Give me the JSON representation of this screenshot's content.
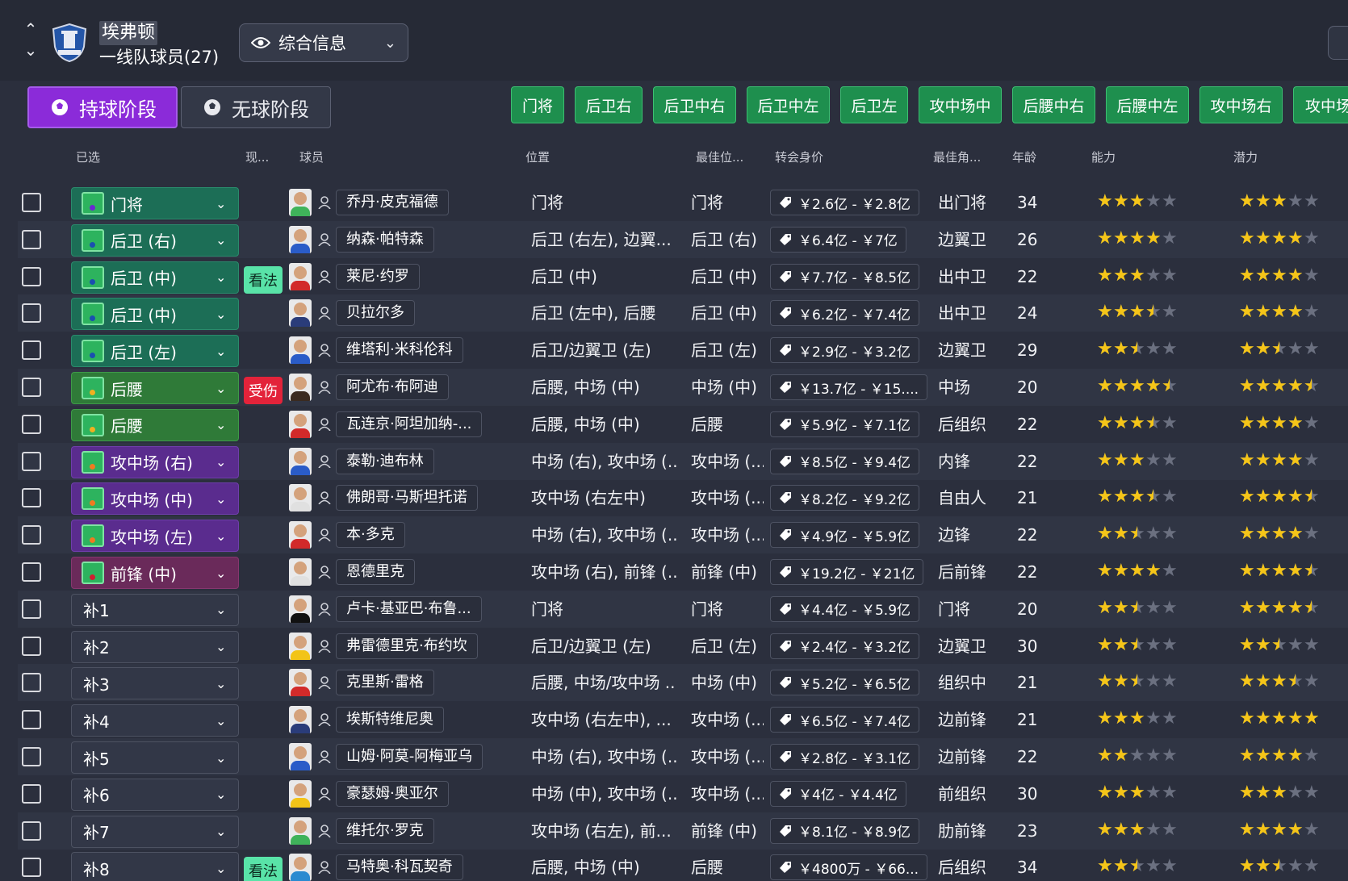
{
  "header": {
    "club_name": "埃弗顿",
    "squad_label": "一线队球员(27)",
    "view_select": "综合信息"
  },
  "phases": {
    "in_possession": "持球阶段",
    "out_of_possession": "无球阶段"
  },
  "position_tabs": [
    "门将",
    "后卫右",
    "后卫中右",
    "后卫中左",
    "后卫左",
    "攻中场中",
    "后腰中右",
    "后腰中左",
    "攻中场右",
    "攻中场"
  ],
  "columns": {
    "selected": "已选",
    "status": "现...",
    "player": "球员",
    "position": "位置",
    "best_position": "最佳位...",
    "transfer_value": "转会身价",
    "best_role": "最佳角...",
    "age": "年龄",
    "ability": "能力",
    "potential": "潜力"
  },
  "colors": {
    "star": "#f5c518",
    "pitch": "#2db35e",
    "phase_active": "#8b2bd9",
    "tab": "#1e8f4e"
  },
  "rows": [
    {
      "role": "门将",
      "type": "gk",
      "tag": "",
      "name": "乔丹·皮克福德",
      "position": "门将",
      "best_pos": "门将",
      "value": "￥2.6亿 - ￥2.8亿",
      "best_role": "出门将",
      "age": "34",
      "ability": 3,
      "potential": 3,
      "kit": "#3fb35a"
    },
    {
      "role": "后卫 (右)",
      "type": "def",
      "tag": "",
      "name": "纳森·帕特森",
      "position": "后卫 (右左), 边翼...",
      "best_pos": "后卫 (右)",
      "value": "￥6.4亿 - ￥7亿",
      "best_role": "边翼卫",
      "age": "26",
      "ability": 4,
      "potential": 4,
      "kit": "#2a5cc8"
    },
    {
      "role": "后卫 (中)",
      "type": "def",
      "tag": "看法",
      "tagType": "view",
      "name": "莱尼·约罗",
      "position": "后卫 (中)",
      "best_pos": "后卫 (中)",
      "value": "￥7.7亿 - ￥8.5亿",
      "best_role": "出中卫",
      "age": "22",
      "ability": 3,
      "potential": 4,
      "kit": "#d22a2a"
    },
    {
      "role": "后卫 (中)",
      "type": "def",
      "tag": "",
      "name": "贝拉尔多",
      "position": "后卫 (左中), 后腰",
      "best_pos": "后卫 (中)",
      "value": "￥6.2亿 - ￥7.4亿",
      "best_role": "出中卫",
      "age": "24",
      "ability": 3.5,
      "potential": 4,
      "kit": "#2a3c7a"
    },
    {
      "role": "后卫 (左)",
      "type": "def",
      "tag": "",
      "name": "维塔利·米科伦科",
      "position": "后卫/边翼卫 (左)",
      "best_pos": "后卫 (左)",
      "value": "￥2.9亿 - ￥3.2亿",
      "best_role": "边翼卫",
      "age": "29",
      "ability": 2.5,
      "potential": 2.5,
      "kit": "#2a5cc8"
    },
    {
      "role": "后腰",
      "type": "dm",
      "tag": "受伤",
      "tagType": "inj",
      "name": "阿尤布·布阿迪",
      "position": "后腰, 中场 (中)",
      "best_pos": "中场 (中)",
      "value": "￥13.7亿 - ￥15....",
      "best_role": "中场",
      "age": "20",
      "ability": 4.5,
      "potential": 4.5,
      "kit": "#3a2a20"
    },
    {
      "role": "后腰",
      "type": "dm",
      "tag": "",
      "name": "瓦连京·阿坦加纳-...",
      "position": "后腰, 中场 (中)",
      "best_pos": "后腰",
      "value": "￥5.9亿 - ￥7.1亿",
      "best_role": "后组织",
      "age": "22",
      "ability": 3.5,
      "potential": 4,
      "kit": "#d22a2a"
    },
    {
      "role": "攻中场 (右)",
      "type": "am",
      "tag": "",
      "name": "泰勒·迪布林",
      "position": "中场 (右), 攻中场 (...",
      "best_pos": "攻中场 (...",
      "value": "￥8.5亿 - ￥9.4亿",
      "best_role": "内锋",
      "age": "22",
      "ability": 3,
      "potential": 4,
      "kit": "#2a5cc8"
    },
    {
      "role": "攻中场 (中)",
      "type": "am",
      "tag": "",
      "name": "佛朗哥·马斯坦托诺",
      "position": "攻中场 (右左中)",
      "best_pos": "攻中场 (...",
      "value": "￥8.2亿 - ￥9.2亿",
      "best_role": "自由人",
      "age": "21",
      "ability": 3.5,
      "potential": 4.5,
      "kit": "#e0e0e0"
    },
    {
      "role": "攻中场 (左)",
      "type": "am",
      "tag": "",
      "name": "本·多克",
      "position": "中场 (右), 攻中场 (...",
      "best_pos": "攻中场 (...",
      "value": "￥4.9亿 - ￥5.9亿",
      "best_role": "边锋",
      "age": "22",
      "ability": 2.5,
      "potential": 4,
      "kit": "#d22a2a"
    },
    {
      "role": "前锋 (中)",
      "type": "st",
      "tag": "",
      "name": "恩德里克",
      "position": "攻中场 (右), 前锋 (...",
      "best_pos": "前锋 (中)",
      "value": "￥19.2亿 - ￥21亿",
      "best_role": "后前锋",
      "age": "22",
      "ability": 4,
      "potential": 4.5,
      "kit": "#e0e0e0"
    },
    {
      "role": "补1",
      "type": "sub",
      "tag": "",
      "name": "卢卡·基亚巴·布鲁...",
      "position": "门将",
      "best_pos": "门将",
      "value": "￥4.4亿 - ￥5.9亿",
      "best_role": "门将",
      "age": "20",
      "ability": 2.5,
      "potential": 4.5,
      "kit": "#111111"
    },
    {
      "role": "补2",
      "type": "sub",
      "tag": "",
      "name": "弗雷德里克·布约坎",
      "position": "后卫/边翼卫 (左)",
      "best_pos": "后卫 (左)",
      "value": "￥2.4亿 - ￥3.2亿",
      "best_role": "边翼卫",
      "age": "30",
      "ability": 2.5,
      "potential": 2.5,
      "kit": "#f2c418"
    },
    {
      "role": "补3",
      "type": "sub",
      "tag": "",
      "name": "克里斯·雷格",
      "position": "后腰, 中场/攻中场 ...",
      "best_pos": "中场 (中)",
      "value": "￥5.2亿 - ￥6.5亿",
      "best_role": "组织中",
      "age": "21",
      "ability": 2.5,
      "potential": 3.5,
      "kit": "#d22a2a"
    },
    {
      "role": "补4",
      "type": "sub",
      "tag": "",
      "name": "埃斯特维尼奥",
      "position": "攻中场 (右左中), ...",
      "best_pos": "攻中场 (...",
      "value": "￥6.5亿 - ￥7.4亿",
      "best_role": "边前锋",
      "age": "21",
      "ability": 3,
      "potential": 5,
      "kit": "#2a3c7a"
    },
    {
      "role": "补5",
      "type": "sub",
      "tag": "",
      "name": "山姆·阿莫-阿梅亚乌",
      "position": "中场 (右), 攻中场 (...",
      "best_pos": "攻中场 (...",
      "value": "￥2.8亿 - ￥3.1亿",
      "best_role": "边前锋",
      "age": "22",
      "ability": 2,
      "potential": 4,
      "kit": "#2a5cc8"
    },
    {
      "role": "补6",
      "type": "sub",
      "tag": "",
      "name": "豪瑟姆·奥亚尔",
      "position": "中场 (中), 攻中场 (...",
      "best_pos": "攻中场 (...",
      "value": "￥4亿 - ￥4.4亿",
      "best_role": "前组织",
      "age": "30",
      "ability": 3,
      "potential": 3,
      "kit": "#f2c418"
    },
    {
      "role": "补7",
      "type": "sub",
      "tag": "",
      "name": "维托尔·罗克",
      "position": "攻中场 (右左), 前...",
      "best_pos": "前锋 (中)",
      "value": "￥8.1亿 - ￥8.9亿",
      "best_role": "肋前锋",
      "age": "23",
      "ability": 3,
      "potential": 4,
      "kit": "#3fb35a"
    },
    {
      "role": "补8",
      "type": "sub",
      "tag": "看法",
      "tagType": "view",
      "name": "马特奥·科瓦契奇",
      "position": "后腰, 中场 (中)",
      "best_pos": "后腰",
      "value": "￥4800万 - ￥66...",
      "best_role": "后组织",
      "age": "34",
      "ability": 2.5,
      "potential": 2.5,
      "kit": "#2a8ad0"
    }
  ]
}
